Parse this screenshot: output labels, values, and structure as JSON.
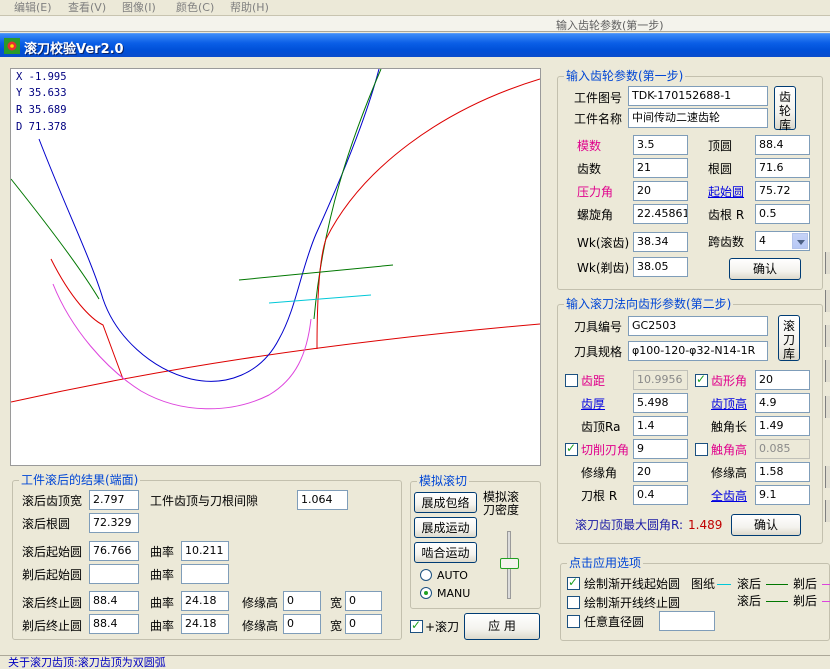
{
  "background_app": {
    "menu": [
      "编辑(E)",
      "查看(V)",
      "图像(I)",
      "颜色(C)",
      "帮助(H)"
    ],
    "strip_text": "输入齿轮参数(第一步)"
  },
  "window": {
    "title": "滚刀校验Ver2.0"
  },
  "readout": {
    "x": "X -1.995",
    "y": "Y 35.633",
    "r": "R 35.689",
    "d": "D 71.378"
  },
  "gear": {
    "title": "输入齿轮参数(第一步)",
    "part_no_label": "工件图号",
    "part_no": "TDK-170152688-1",
    "part_name_label": "工件名称",
    "part_name": "中间传动二速齿轮",
    "library_button": "齿轮库",
    "module_label": "模数",
    "module": "3.5",
    "tip_label": "顶圆",
    "tip": "88.4",
    "teeth_label": "齿数",
    "teeth": "21",
    "root_label": "根圆",
    "root": "71.6",
    "pressure_label": "压力角",
    "pressure": "20",
    "start_label": "起始圆",
    "start": "75.72",
    "helix_label": "螺旋角",
    "helix": "22.45861",
    "root_r_label": "齿根 R",
    "root_r": "0.5",
    "wk_hob_label": "Wk(滚齿)",
    "wk_hob": "38.34",
    "span_label": "跨齿数",
    "span": "4",
    "wk_shave_label": "Wk(剃齿)",
    "wk_shave": "38.05",
    "confirm": "确认"
  },
  "hob": {
    "title": "输入滚刀法向齿形参数(第二步)",
    "tool_no_label": "刀具编号",
    "tool_no": "GC2503",
    "tool_spec_label": "刀具规格",
    "tool_spec": "φ100-120-φ32-N14-1R",
    "library_button": "滚刀库",
    "pitch_label": "齿距",
    "pitch": "10.9956",
    "profile_angle_label": "齿形角",
    "profile_angle": "20",
    "thickness_label": "齿厚",
    "thickness": "5.498",
    "addendum_label": "齿顶高",
    "addendum": "4.9",
    "tip_ra_label": "齿顶Ra",
    "tip_ra": "1.4",
    "protub_len_label": "触角长",
    "protub_len": "1.49",
    "chamfer_label": "切削刃角",
    "chamfer": "9",
    "protub_h_label": "触角高",
    "protub_h": "0.085",
    "mod_angle_label": "修缘角",
    "mod_angle": "20",
    "mod_h_label": "修缘高",
    "mod_h": "1.58",
    "root_r_label": "刀根 R",
    "root_r": "0.4",
    "total_h_label": "全齿高",
    "total_h": "9.1",
    "max_tip_label": "滚刀齿顶最大圆角R:",
    "max_tip": "1.489",
    "confirm": "确认"
  },
  "result": {
    "title": "工件滚后的结果(端面)",
    "land_label": "滚后齿顶宽",
    "land": "2.797",
    "clearance_label": "工件齿顶与刀根间隙",
    "clearance": "1.064",
    "root_label": "滚后根圆",
    "root": "72.329",
    "start_label": "滚后起始圆",
    "start": "76.766",
    "curv_label": "曲率",
    "curv1": "10.211",
    "shave_start_label": "剃后起始圆",
    "shave_start": "",
    "curv2": "",
    "end_label": "滚后终止圆",
    "end": "88.4",
    "curv3": "24.18",
    "mod_h_label": "修缘高",
    "mod_h1": "0",
    "width_label": "宽",
    "width1": "0",
    "shave_end_label": "剃后终止圆",
    "shave_end": "88.4",
    "curv4": "24.18",
    "mod_h2": "0",
    "width2": "0"
  },
  "sim": {
    "title": "模拟滚切",
    "btn_envelope": "展成包络",
    "btn_motion": "展成运动",
    "btn_mesh": "啮合运动",
    "density_label": "模拟滚刀密度",
    "auto": "AUTO",
    "manu": "MANU",
    "hob_check": "+滚刀",
    "apply": "应 用"
  },
  "options": {
    "title": "点击应用选项",
    "opt1": "绘制渐开线起始圆",
    "opt2": "绘制渐开线终止圆",
    "opt3": "任意直径圆",
    "drawing": "图纸",
    "after_hob": "滚后",
    "after_shave": "剃后",
    "after_hob2": "滚后",
    "after_shave2": "剃后"
  },
  "status": {
    "text": "关于滚刀齿顶:滚刀齿顶为双圆弧"
  },
  "colors": {
    "involute": "#ff0000",
    "tooth": "#0000cc",
    "hob_path": "#dd44dd",
    "green": "#007700",
    "cyan": "#00c8d8",
    "title_blue": "#0046d5",
    "pink_label": "#e0008c"
  }
}
